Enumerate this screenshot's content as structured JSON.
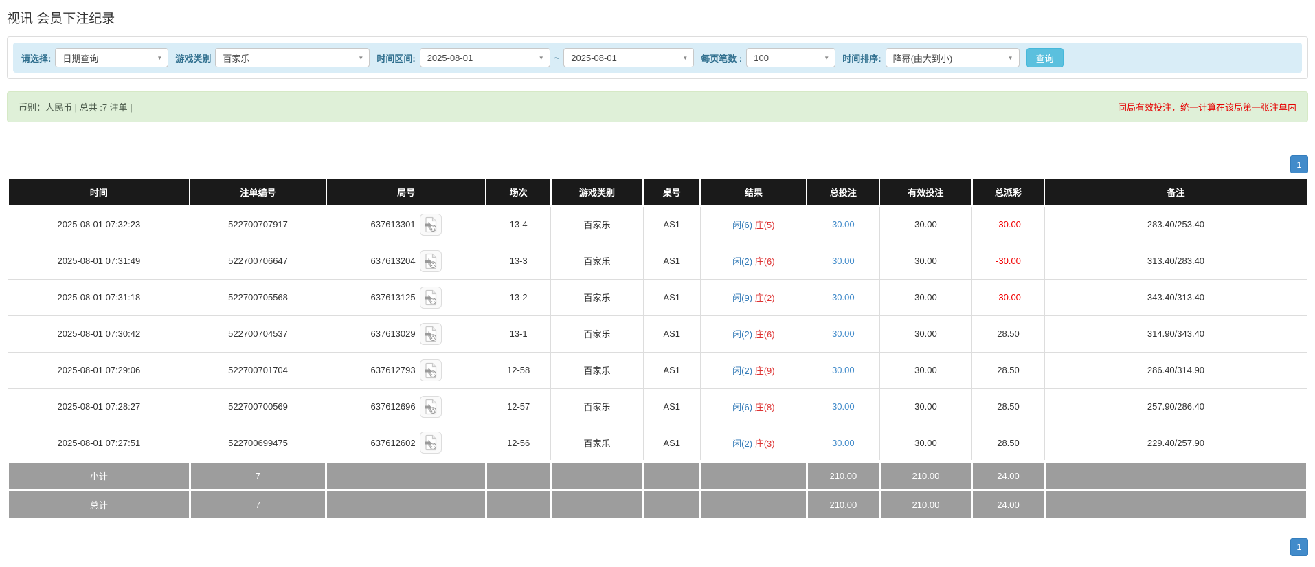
{
  "page": {
    "title": "视讯 会员下注纪录"
  },
  "filter": {
    "select_label": "请选择:",
    "select_value": "日期查询",
    "game_type_label": "游戏类别",
    "game_type_value": "百家乐",
    "time_range_label": "时间区间:",
    "date_from": "2025-08-01",
    "range_separator": "~",
    "date_to": "2025-08-01",
    "page_size_label": "每页笔数 :",
    "page_size_value": "100",
    "sort_label": "时间排序:",
    "sort_value": "降幂(由大到小)",
    "search_button": "查询"
  },
  "summary": {
    "currency_info": "币别：人民币 | 总共 :7 注单 |",
    "notice": "同局有效投注，统一计算在该局第一张注单内"
  },
  "pagination": {
    "page": "1"
  },
  "table": {
    "headers": [
      "时间",
      "注单编号",
      "局号",
      "场次",
      "游戏类别",
      "桌号",
      "结果",
      "总投注",
      "有效投注",
      "总派彩",
      "备注"
    ],
    "rows": [
      {
        "time": "2025-08-01 07:32:23",
        "bet_no": "522700707917",
        "round_no": "637613301",
        "session": "13-4",
        "game_type": "百家乐",
        "table_no": "AS1",
        "result_player": "闲(6)",
        "result_banker": "庄(5)",
        "total_bet": "30.00",
        "valid_bet": "30.00",
        "payout": "-30.00",
        "remark": "283.40/253.40"
      },
      {
        "time": "2025-08-01 07:31:49",
        "bet_no": "522700706647",
        "round_no": "637613204",
        "session": "13-3",
        "game_type": "百家乐",
        "table_no": "AS1",
        "result_player": "闲(2)",
        "result_banker": "庄(6)",
        "total_bet": "30.00",
        "valid_bet": "30.00",
        "payout": "-30.00",
        "remark": "313.40/283.40"
      },
      {
        "time": "2025-08-01 07:31:18",
        "bet_no": "522700705568",
        "round_no": "637613125",
        "session": "13-2",
        "game_type": "百家乐",
        "table_no": "AS1",
        "result_player": "闲(9)",
        "result_banker": "庄(2)",
        "total_bet": "30.00",
        "valid_bet": "30.00",
        "payout": "-30.00",
        "remark": "343.40/313.40"
      },
      {
        "time": "2025-08-01 07:30:42",
        "bet_no": "522700704537",
        "round_no": "637613029",
        "session": "13-1",
        "game_type": "百家乐",
        "table_no": "AS1",
        "result_player": "闲(2)",
        "result_banker": "庄(6)",
        "total_bet": "30.00",
        "valid_bet": "30.00",
        "payout": "28.50",
        "remark": "314.90/343.40"
      },
      {
        "time": "2025-08-01 07:29:06",
        "bet_no": "522700701704",
        "round_no": "637612793",
        "session": "12-58",
        "game_type": "百家乐",
        "table_no": "AS1",
        "result_player": "闲(2)",
        "result_banker": "庄(9)",
        "total_bet": "30.00",
        "valid_bet": "30.00",
        "payout": "28.50",
        "remark": "286.40/314.90"
      },
      {
        "time": "2025-08-01 07:28:27",
        "bet_no": "522700700569",
        "round_no": "637612696",
        "session": "12-57",
        "game_type": "百家乐",
        "table_no": "AS1",
        "result_player": "闲(6)",
        "result_banker": "庄(8)",
        "total_bet": "30.00",
        "valid_bet": "30.00",
        "payout": "28.50",
        "remark": "257.90/286.40"
      },
      {
        "time": "2025-08-01 07:27:51",
        "bet_no": "522700699475",
        "round_no": "637612602",
        "session": "12-56",
        "game_type": "百家乐",
        "table_no": "AS1",
        "result_player": "闲(2)",
        "result_banker": "庄(3)",
        "total_bet": "30.00",
        "valid_bet": "30.00",
        "payout": "28.50",
        "remark": "229.40/257.90"
      }
    ],
    "subtotal": {
      "label": "小计",
      "count": "7",
      "total_bet": "210.00",
      "valid_bet": "210.00",
      "payout": "24.00"
    },
    "grand_total": {
      "label": "总计",
      "count": "7",
      "total_bet": "210.00",
      "valid_bet": "210.00",
      "payout": "24.00"
    }
  },
  "colors": {
    "accent": "#428bca",
    "search_button": "#5bc0de",
    "filter_bar_bg": "#d9edf7",
    "summary_bg": "#dff0d8",
    "table_header_bg": "#1a1a1a",
    "footer_row_bg": "#9d9d9d",
    "negative_value": "#f00000",
    "notice_red": "#e60000",
    "player_blue": "#337ab7",
    "banker_red": "#dd3333"
  }
}
